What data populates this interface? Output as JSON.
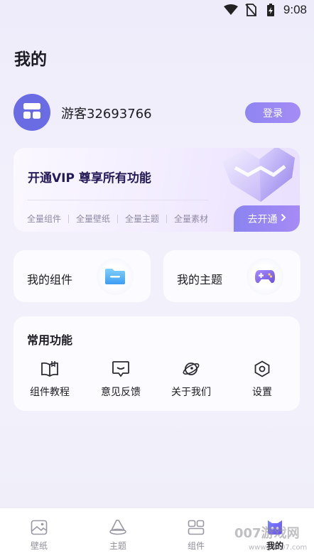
{
  "status_bar": {
    "time": "9:08",
    "icons": [
      "wifi-icon",
      "no-sim-icon",
      "battery-charging-icon"
    ]
  },
  "page": {
    "title": "我的"
  },
  "user": {
    "avatar_icon": "layout-grid-icon",
    "name": "游客32693766",
    "login_label": "登录"
  },
  "vip": {
    "title": "开通VIP 尊享所有功能",
    "features": [
      "全量组件",
      "全量壁纸",
      "全量主题",
      "全量素材"
    ],
    "cta_label": "去开通"
  },
  "shortcuts": [
    {
      "label": "我的组件",
      "icon": "folder-icon"
    },
    {
      "label": "我的主题",
      "icon": "gamepad-icon"
    }
  ],
  "functions": {
    "title": "常用功能",
    "items": [
      {
        "label": "组件教程",
        "icon": "book-icon"
      },
      {
        "label": "意见反馈",
        "icon": "feedback-icon"
      },
      {
        "label": "关于我们",
        "icon": "planet-icon"
      },
      {
        "label": "设置",
        "icon": "settings-icon"
      }
    ]
  },
  "nav": {
    "items": [
      {
        "label": "壁纸",
        "icon": "wallpaper-icon"
      },
      {
        "label": "主题",
        "icon": "theme-icon"
      },
      {
        "label": "组件",
        "icon": "widgets-icon"
      },
      {
        "label": "我的",
        "icon": "profile-icon"
      }
    ],
    "active": "我的"
  },
  "watermark": {
    "text": "007游戏网",
    "url": "www.yx007.com"
  },
  "colors": {
    "accent": "#8f85f2",
    "avatar": "#6a6ce3",
    "vip_title": "#251a58"
  }
}
